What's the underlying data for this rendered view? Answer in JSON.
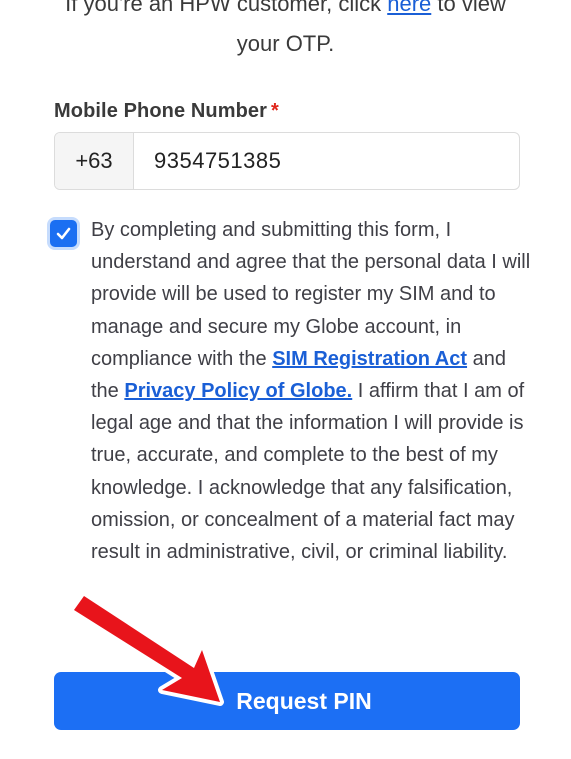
{
  "intro": {
    "line1_prefix": "If you're an HPW customer, click ",
    "line1_link": "here",
    "line1_suffix": " to view",
    "line2": "your OTP."
  },
  "phone_field": {
    "label": "Mobile Phone Number",
    "required_mark": "*",
    "country_code": "+63",
    "value": "9354751385"
  },
  "consent": {
    "checked": true,
    "text_part1": "By completing and submitting this form, I understand and agree that the personal data I will provide will be used to register my SIM and to manage and secure my Globe account, in compliance with the ",
    "link_sim_act": "SIM Registration Act",
    "text_part2": " and the ",
    "link_privacy": "Privacy Policy of Globe.",
    "text_part3": " I affirm that I am of legal age and that the information I will provide is true, accurate, and complete to the best of my knowledge. I acknowledge that any falsification, omission, or concealment of a material fact may result in administrative, civil, or criminal liability."
  },
  "actions": {
    "request_pin_label": "Request PIN"
  },
  "colors": {
    "primary": "#1c6ff4",
    "link": "#1a5fd6",
    "required": "#e0261b",
    "arrow": "#e8141b"
  }
}
